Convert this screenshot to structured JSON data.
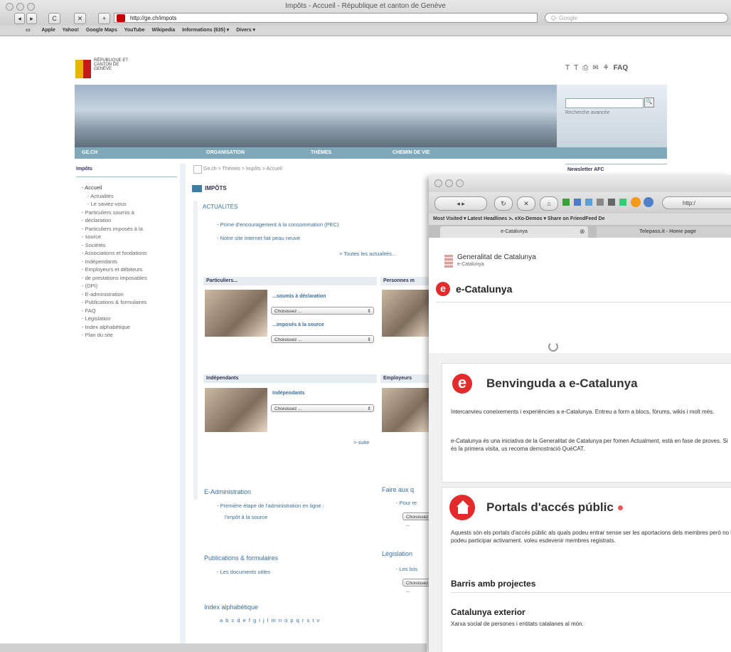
{
  "safari": {
    "window_title": "Impôts - Accueil - République et canton de Genève",
    "url": "http://ge.ch/impots",
    "search_placeholder": "Q- Google",
    "nav": {
      "back": "◂",
      "forward": "▸",
      "reload": "C",
      "stop": "✕",
      "add": "+"
    },
    "bookmarks": [
      "Apple",
      "Yahoo!",
      "Google Maps",
      "YouTube",
      "Wikipedia",
      "Informations (635) ▾",
      "Divers ▾"
    ]
  },
  "gech": {
    "logo_text": "RÉPUBLIQUE ET CANTON DE GENÈVE",
    "top_icons": [
      "T",
      "T",
      "⎙",
      "✉",
      "⚘"
    ],
    "faq": "FAQ",
    "search_link": "Recherche avancée",
    "search_btn": "🔍",
    "nav": [
      "GE.CH",
      "ORGANISATION",
      "THÈMES",
      "CHEMIN DE VIE"
    ],
    "sidebar_head": "Impôts",
    "sidebar_items": [
      {
        "label": "Accueil",
        "sub": false
      },
      {
        "label": "Actualités",
        "sub": true
      },
      {
        "label": "Le saviez-vous",
        "sub": true
      },
      {
        "label": "Particuliers soumis à",
        "sub": false
      },
      {
        "label": "déclaration",
        "sub": false
      },
      {
        "label": "Particuliers imposés à la",
        "sub": false
      },
      {
        "label": "source",
        "sub": false
      },
      {
        "label": "Sociétés",
        "sub": false
      },
      {
        "label": "Associations et fondations",
        "sub": false
      },
      {
        "label": "Indépendants",
        "sub": false
      },
      {
        "label": "Employeurs et débiteurs",
        "sub": false
      },
      {
        "label": "de prestations imposables",
        "sub": false
      },
      {
        "label": "(DPI)",
        "sub": false
      },
      {
        "label": "E-administration",
        "sub": false
      },
      {
        "label": "Publications & formulaires",
        "sub": false
      },
      {
        "label": "FAQ",
        "sub": false
      },
      {
        "label": "Législation",
        "sub": false
      },
      {
        "label": "Index alphabétique",
        "sub": false
      },
      {
        "label": "Plan du site",
        "sub": false
      }
    ],
    "breadcrumb": "Ge.ch > Thèmes > Impôts > Accueil",
    "page_title": "IMPÔTS",
    "actualites_head": "ACTUALITÉS",
    "actualites": [
      "Prime d'encouragement à la consommation (PEC)",
      "Notre site internet fait peau neuve"
    ],
    "all_news": "> Toutes les actualités...",
    "particuliers_head": "Particuliers...",
    "soumis_link": "...soumis à déclaration",
    "source_link": "...imposés à la source",
    "select_placeholder": "Choisissez ...",
    "personnes_head": "Personnes m",
    "independants_head": "Indépendants",
    "independants_link": "Indépendants",
    "employeurs_head": "Employeurs",
    "suite": "> suite",
    "eadmin_head": "E-Administration",
    "eadmin_link_1": "Première étape de l'administration en ligne :",
    "eadmin_link_2": "l'impôt à la source",
    "faire_head": "Faire aux q",
    "pour_link": "Pour re",
    "publications_head": "Publications & formulaires",
    "documents_link": "Les documents utiles",
    "legislation_head": "Législation",
    "lois_link": "Les lois",
    "index_head": "Index alphabétique",
    "index_letters": "a b c d e f g i j l m n o p q r s t v",
    "newsletter": "Newsletter AFC"
  },
  "firefox": {
    "bookmarks": "Most Visited ▾   Latest Headlines ⋋   eXo-Demos ▾   Share on FriendFeed   De",
    "tab1": "e-Catalunya",
    "tab2": "Telepass.it - Home page",
    "url_partial": "http:/",
    "gen_title": "Generalitat de Catalunya",
    "gen_sub": "e-Catalunya",
    "ecat_letter": "e",
    "ecat_title": "e-Catalunya",
    "welcome_title": "Benvinguda a e-Catalunya",
    "welcome_p1": "Intercanvieu coneixements i experiències a e-Catalunya. Entreu a form a blocs, fòrums, wikis i molt més.",
    "welcome_p2": "e-Catalunya és una iniciativa de la Generalitat de Catalunya per fomen Actualment, està en fase de proves. Si és la primera visita, us recoma demostració QuèCAT.",
    "portals_title": "Portals d'accés públic",
    "portals_p": "Aquests són els portals d'accés públic als quals podeu entrar sense ser les aportacions dels membres però no hi podeu participar activament. voleu esdevenir membres registrats.",
    "barris": "Barris amb projectes",
    "catalunya_ext": "Catalunya exterior",
    "catalunya_ext_p": "Xarxa social de persones i entitats catalanes al món."
  }
}
